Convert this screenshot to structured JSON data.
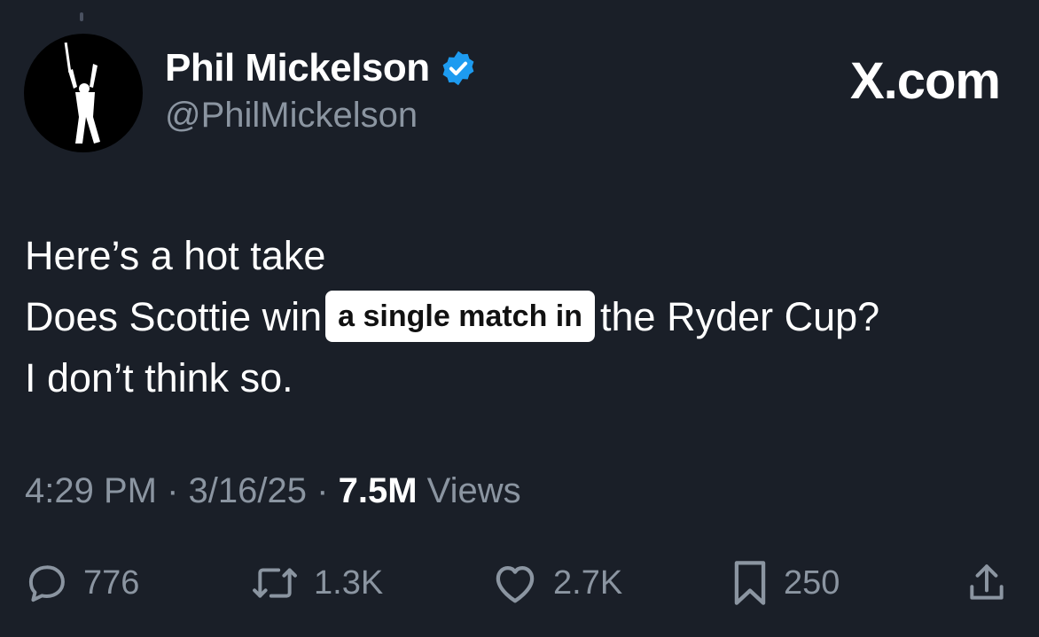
{
  "author": {
    "display_name": "Phil Mickelson",
    "handle": "@PhilMickelson",
    "verified": true,
    "avatar_icon": "golfer-silhouette-icon"
  },
  "brand": "X.com",
  "tweet": {
    "line1": "Here’s a hot take",
    "line2_before": "Does Scottie win",
    "line2_highlight": "a single match in",
    "line2_after": "the Ryder Cup?",
    "line3": "I don’t think so."
  },
  "meta": {
    "time": "4:29 PM",
    "separator": "·",
    "date": "3/16/25",
    "views_count": "7.5M",
    "views_label": "Views"
  },
  "actions": {
    "replies": "776",
    "reposts": "1.3K",
    "likes": "2.7K",
    "bookmarks": "250"
  },
  "colors": {
    "background": "#1a1f28",
    "muted_text": "#8b95a1",
    "verified_blue": "#1d9bf0"
  }
}
